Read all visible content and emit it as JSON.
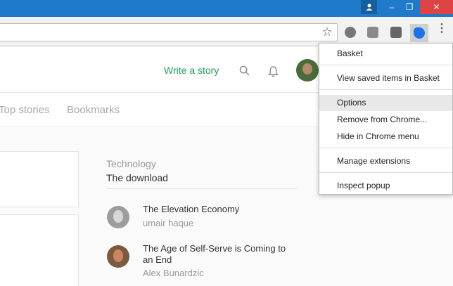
{
  "window": {
    "controls": {
      "minimize": "–",
      "restore": "❐",
      "close": "✕"
    }
  },
  "toolbar": {
    "star_icon": "☆",
    "extensions": [
      "ext-a-icon",
      "ext-b-icon",
      "ext-c-icon",
      "basket-extension-icon"
    ],
    "menu_icon": "⋮"
  },
  "header": {
    "write_story": "Write a story"
  },
  "nav": {
    "items": [
      "Top stories",
      "Bookmarks"
    ]
  },
  "sidebar": {
    "section_label": "Technology",
    "section_title": "The download",
    "stories": [
      {
        "title": "The Elevation Economy",
        "author": "umair haque"
      },
      {
        "title": "The Age of Self-Serve is Coming to an End",
        "author": "Alex Bunardzic"
      }
    ]
  },
  "context_menu": {
    "items": [
      {
        "label": "Basket"
      },
      {
        "label": "View saved items in Basket"
      },
      {
        "label": "Options",
        "highlighted": true
      },
      {
        "label": "Remove from Chrome..."
      },
      {
        "label": "Hide in Chrome menu"
      },
      {
        "label": "Manage extensions"
      },
      {
        "label": "Inspect popup"
      }
    ]
  },
  "colors": {
    "titlebar": "#1f7acb",
    "close_button": "#e04343",
    "accent_green": "#1f9f56",
    "extension_blue": "#1a73e8"
  }
}
